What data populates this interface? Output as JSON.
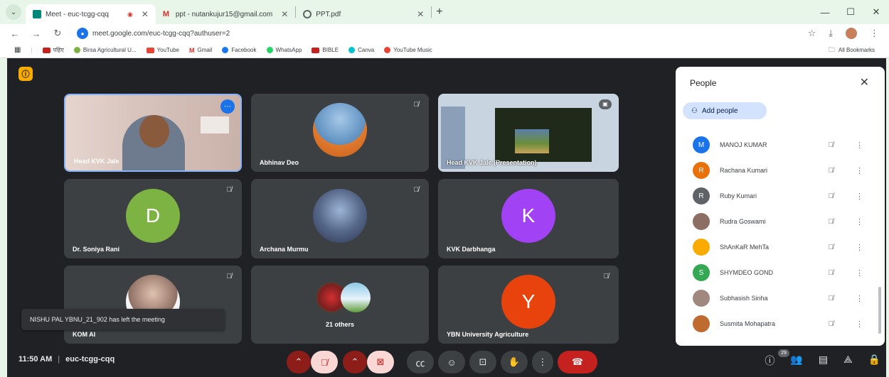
{
  "browser": {
    "tabs": [
      {
        "title": "Meet - euc-tcgg-cqq",
        "active": true
      },
      {
        "title": "ppt - nutankujur15@gmail.com",
        "active": false
      },
      {
        "title": "PPT.pdf",
        "active": false
      }
    ],
    "tab_list_glyph": "⌄",
    "new_tab_glyph": "+",
    "url": "meet.google.com/euc-tcgg-cqq?authuser=2",
    "bookmarks": [
      {
        "label": "पहिए",
        "color": "#c5221f"
      },
      {
        "label": "Birsa Agricultural U...",
        "color": "#7cb342"
      },
      {
        "label": "YouTube",
        "color": "#ea4335"
      },
      {
        "label": "Gmail",
        "color": "#d93025"
      },
      {
        "label": "Facebook",
        "color": "#1877f2"
      },
      {
        "label": "WhatsApp",
        "color": "#25d366"
      },
      {
        "label": "BIBLE",
        "color": "#c5221f"
      },
      {
        "label": "Canva",
        "color": "#00c4cc"
      },
      {
        "label": "YouTube Music",
        "color": "#ea4335"
      }
    ],
    "all_bookmarks": "All Bookmarks"
  },
  "tiles": [
    {
      "name": "Head KVK Jale",
      "type": "video"
    },
    {
      "name": "Abhinav Deo",
      "type": "photo",
      "color": "#4a90c2"
    },
    {
      "name": "Head KVK Jale (Presentation)",
      "type": "presentation"
    },
    {
      "name": "Dr. Soniya Rani",
      "type": "letter",
      "letter": "D",
      "color": "#7cb342"
    },
    {
      "name": "Archana Murmu",
      "type": "photo",
      "color": "#5d6d8a"
    },
    {
      "name": "KVK Darbhanga",
      "type": "letter",
      "letter": "K",
      "color": "#a142f4"
    },
    {
      "name": "KOM AI",
      "type": "photo",
      "color": "#8d6e63"
    },
    {
      "name": "21 others",
      "type": "group"
    },
    {
      "name": "YBN University Agriculture",
      "type": "letter",
      "letter": "Y",
      "color": "#e8430c"
    }
  ],
  "toast": "NISHU PAL YBNU_21_902 has left the meeting",
  "meeting": {
    "time": "11:50 AM",
    "code": "euc-tcgg-cqq",
    "participant_count": "29"
  },
  "people_panel": {
    "title": "People",
    "add_people": "Add people",
    "participants": [
      {
        "name": "MANOJ KUMAR",
        "initial": "M",
        "color": "#1a73e8"
      },
      {
        "name": "Rachana Kumari",
        "initial": "R",
        "color": "#e8710a"
      },
      {
        "name": "Ruby Kumari",
        "initial": "R",
        "color": "#5f6368"
      },
      {
        "name": "Rudra Goswami",
        "initial": "",
        "color": "#8d6e63"
      },
      {
        "name": "ShAnKaR MehTa",
        "initial": "",
        "color": "#f9ab00"
      },
      {
        "name": "SHYMDEO GOND",
        "initial": "S",
        "color": "#34a853"
      },
      {
        "name": "Subhasish Sinha",
        "initial": "",
        "color": "#a1887f"
      },
      {
        "name": "Susmita Mohapatra",
        "initial": "",
        "color": "#bf6a2e"
      }
    ]
  }
}
